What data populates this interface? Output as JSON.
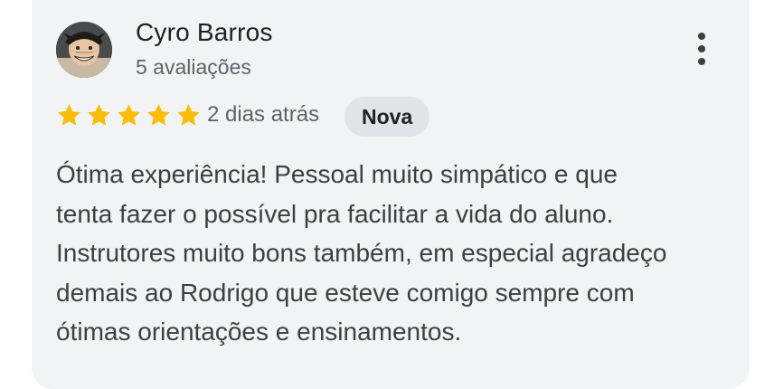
{
  "review": {
    "author_name": "Cyro Barros",
    "author_reviews": "5 avaliações",
    "avatar_icon": "user-avatar",
    "menu_icon": "more-vert-icon",
    "rating": 5,
    "rating_max": 5,
    "star_color": "#fbbc04",
    "time": "2 dias atrás",
    "badge": "Nova",
    "text_lines": [
      "Ótima experiência! Pessoal muito simpático e que",
      "tenta fazer o possível pra facilitar a vida do aluno.",
      "Instrutores muito bons também, em especial agradeço",
      "demais ao Rodrigo que esteve comigo sempre com",
      "ótimas orientações e ensinamentos."
    ]
  }
}
